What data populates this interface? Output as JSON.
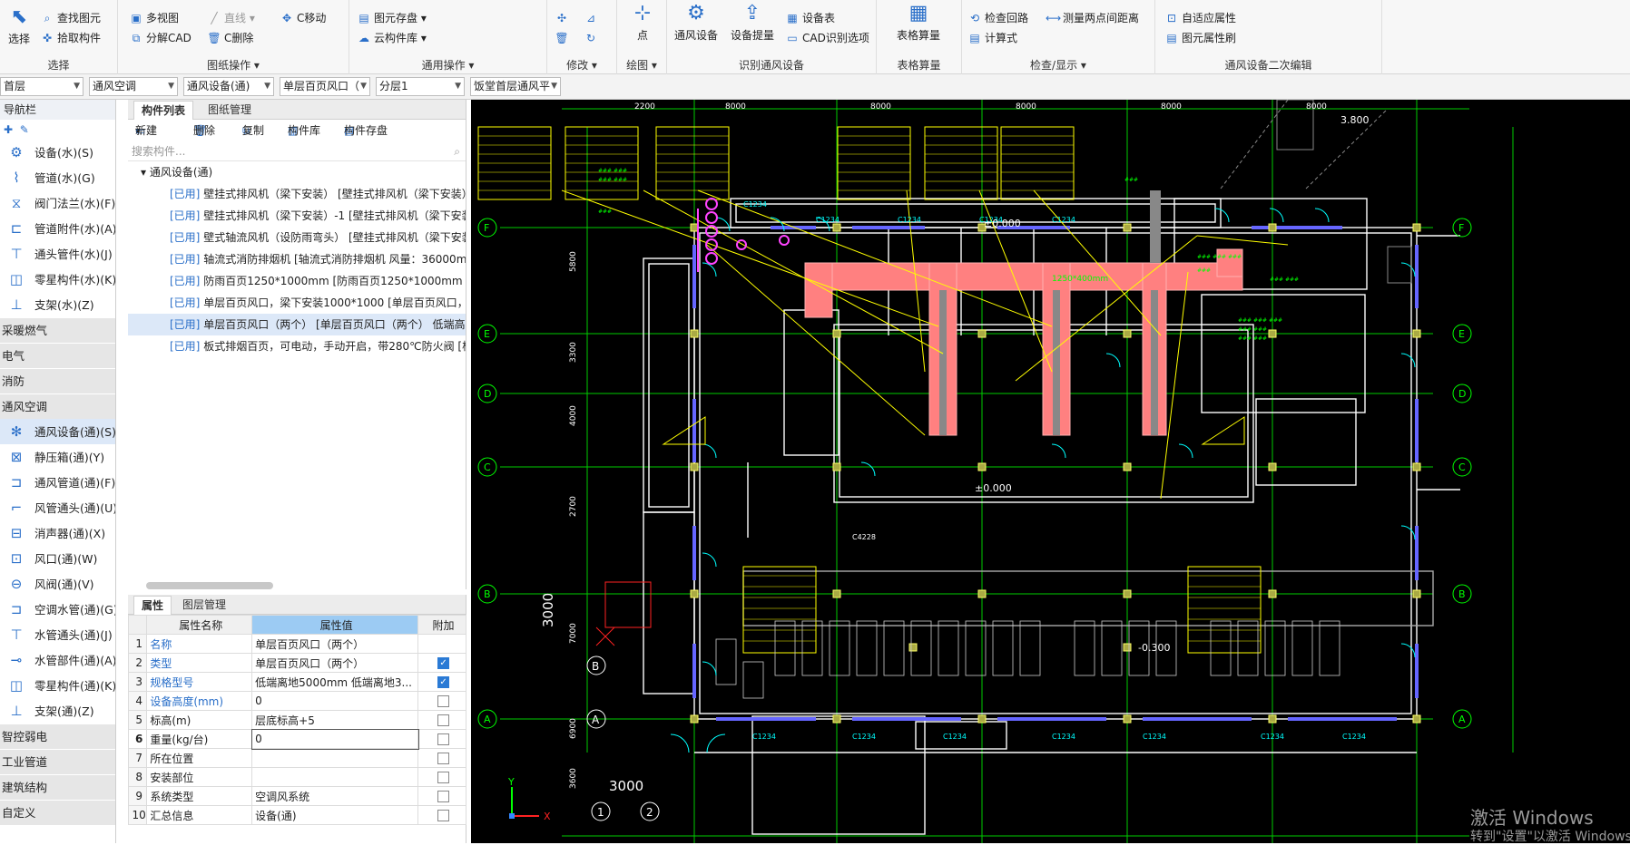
{
  "ribbon": {
    "select": {
      "label": "选择",
      "group": "选择",
      "find": "查找图元",
      "pick": "拾取构件"
    },
    "drawing": {
      "group": "图纸操作",
      "multiview": "多视图",
      "split": "分解CAD",
      "line": "直线",
      "move": "C移动",
      "delete": "C删除"
    },
    "common": {
      "group": "通用操作",
      "store": "图元存盘",
      "cloud": "云构件库"
    },
    "modify": {
      "group": "修改"
    },
    "draw": {
      "group": "绘图",
      "point": "点"
    },
    "identify": {
      "group": "识别通风设备",
      "equip": "通风设备",
      "extract": "设备提量",
      "table": "设备表",
      "cadopt": "CAD识别选项"
    },
    "calc": {
      "group": "表格算量",
      "label": "表格算量"
    },
    "check": {
      "group": "检查/显示",
      "loop": "检查回路",
      "measure": "测量两点间距离",
      "formula": "计算式"
    },
    "edit2": {
      "group": "通风设备二次编辑",
      "adapt": "自适应属性",
      "brush": "图元属性刷"
    }
  },
  "combos": [
    "首层",
    "通风空调",
    "通风设备(通)",
    "单层百页风口（",
    "分层1",
    "饭堂首层通风平"
  ],
  "nav": {
    "title": "导航栏",
    "items": [
      {
        "label": "设备(水)(S)",
        "icon": "pump-icon"
      },
      {
        "label": "管道(水)(G)",
        "icon": "pipe-icon"
      },
      {
        "label": "阀门法兰(水)(F)",
        "icon": "valve-icon"
      },
      {
        "label": "管道附件(水)(A)",
        "icon": "fitting-icon"
      },
      {
        "label": "通头管件(水)(J)",
        "icon": "tee-icon"
      },
      {
        "label": "零星构件(水)(K)",
        "icon": "parts-icon"
      },
      {
        "label": "支架(水)(Z)",
        "icon": "bracket-icon"
      }
    ],
    "cats": [
      "采暖燃气",
      "电气",
      "消防",
      "通风空调"
    ],
    "vent_items": [
      {
        "label": "通风设备(通)(S)",
        "icon": "fan-icon"
      },
      {
        "label": "静压箱(通)(Y)",
        "icon": "box-icon"
      },
      {
        "label": "通风管道(通)(F)",
        "icon": "duct-icon"
      },
      {
        "label": "风管通头(通)(U)",
        "icon": "duct-tee-icon"
      },
      {
        "label": "消声器(通)(X)",
        "icon": "silencer-icon"
      },
      {
        "label": "风口(通)(W)",
        "icon": "vent-icon"
      },
      {
        "label": "风阀(通)(V)",
        "icon": "damper-icon"
      },
      {
        "label": "空调水管(通)(G)",
        "icon": "water-pipe-icon"
      },
      {
        "label": "水管通头(通)(J)",
        "icon": "water-tee-icon"
      },
      {
        "label": "水管部件(通)(A)",
        "icon": "water-part-icon"
      },
      {
        "label": "零星构件(通)(K)",
        "icon": "parts-icon"
      },
      {
        "label": "支架(通)(Z)",
        "icon": "bracket-icon"
      }
    ],
    "cats2": [
      "智控弱电",
      "工业管道",
      "建筑结构",
      "自定义"
    ]
  },
  "list": {
    "tab1": "构件列表",
    "tab2": "图纸管理",
    "new": "新建",
    "del": "删除",
    "copy": "复制",
    "lib": "构件库",
    "store": "构件存盘",
    "search": "搜索构件...",
    "root": "通风设备(通)",
    "used": "[已用]",
    "items": [
      "壁挂式排风机（梁下安装） [壁挂式排风机（梁下安装）",
      "壁挂式排风机（梁下安装）-1 [壁挂式排风机（梁下安装",
      "壁式轴流风机（设防雨弯头） [壁挂式排风机（梁下安装",
      "轴流式消防排烟机 [轴流式消防排烟机 风量：36000m3",
      "防雨百页1250*1000mm [防雨百页1250*1000mm 125",
      "单层百页风口，梁下安装1000*1000 [单层百页风口，梁",
      "单层百页风口（两个） [单层百页风口（两个） 低端高",
      "板式排烟百页，可电动，手动开启，带280℃防火阀 [板"
    ]
  },
  "props": {
    "tab1": "属性",
    "tab2": "图层管理",
    "h_name": "属性名称",
    "h_val": "属性值",
    "h_add": "附加",
    "rows": [
      {
        "n": "1",
        "name": "名称",
        "val": "单层百页风口（两个）",
        "cb": "none"
      },
      {
        "n": "2",
        "name": "类型",
        "val": "单层百页风口（两个）",
        "cb": "on"
      },
      {
        "n": "3",
        "name": "规格型号",
        "val": "低端离地5000mm 低端离地3...",
        "cb": "on"
      },
      {
        "n": "4",
        "name": "设备高度(mm)",
        "val": "0",
        "cb": "off"
      },
      {
        "n": "5",
        "name": "标高(m)",
        "val": "层底标高+5",
        "cb": "off"
      },
      {
        "n": "6",
        "name": "重量(kg/台)",
        "val": "0",
        "cb": "off"
      },
      {
        "n": "7",
        "name": "所在位置",
        "val": "",
        "cb": "off"
      },
      {
        "n": "8",
        "name": "安装部位",
        "val": "",
        "cb": "off"
      },
      {
        "n": "9",
        "name": "系统类型",
        "val": "空调风系统",
        "cb": "off"
      },
      {
        "n": "10",
        "name": "汇总信息",
        "val": "设备(通)",
        "cb": "off"
      }
    ]
  },
  "cad": {
    "axes_left": [
      "F",
      "E",
      "D",
      "C",
      "B",
      "A"
    ],
    "axes_right": [
      "F",
      "E",
      "D",
      "C",
      "B",
      "A"
    ],
    "dims_top": [
      "2200",
      "8000",
      "8000",
      "8000",
      "8000",
      "8000"
    ],
    "dims_left": [
      "5800",
      "3300",
      "4000",
      "2700",
      "7000",
      "6900",
      "3600"
    ],
    "elev1": "±0.000",
    "elev2": "±0.000",
    "elev3": "-0.300",
    "elev4": "3.800",
    "dim3000a": "3000",
    "dim3000b": "3000",
    "bmark": "B",
    "amark": "A",
    "n1": "1",
    "n2": "2",
    "c1234": "C1234",
    "c4228": "C4228",
    "duct": "1250*400mm",
    "xy_y": "Y",
    "xy_x": "X"
  },
  "watermark": {
    "line1": "激活 Windows",
    "line2": "转到\"设置\"以激活 Windows"
  },
  "colors": {
    "accent": "#2a6fc9",
    "green": "#00ff00",
    "duct": "#ff7f7f",
    "yellow": "#ffff00",
    "cyan": "#00ffff"
  }
}
